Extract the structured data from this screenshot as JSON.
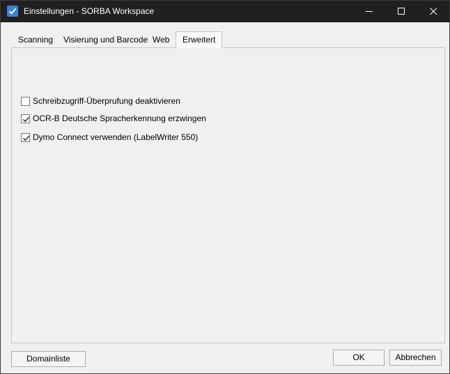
{
  "window": {
    "title": "Einstellungen - SORBA Workspace",
    "icons": [
      "app-check-icon",
      "minimize-icon",
      "maximize-icon",
      "close-icon"
    ]
  },
  "tabs": [
    {
      "label": "Scanning",
      "active": false
    },
    {
      "label": "Visierung und Barcode",
      "active": false
    },
    {
      "label": "Web",
      "active": false
    },
    {
      "label": "Erweitert",
      "active": true
    }
  ],
  "options": [
    {
      "label": "Schreibzugriff-Überprufung deaktivieren",
      "checked": false
    },
    {
      "label": "OCR-B Deutsche Spracherkennung erzwingen",
      "checked": true
    },
    {
      "label": "Dymo Connect verwenden (LabelWriter 550)",
      "checked": true
    }
  ],
  "buttons": {
    "domain_list": "Domainliste",
    "ok": "OK",
    "cancel": "Abbrechen"
  },
  "colors": {
    "titlebar": "#202020",
    "dialog_bg": "#f0f0f0",
    "accent": "#3b82d6"
  }
}
